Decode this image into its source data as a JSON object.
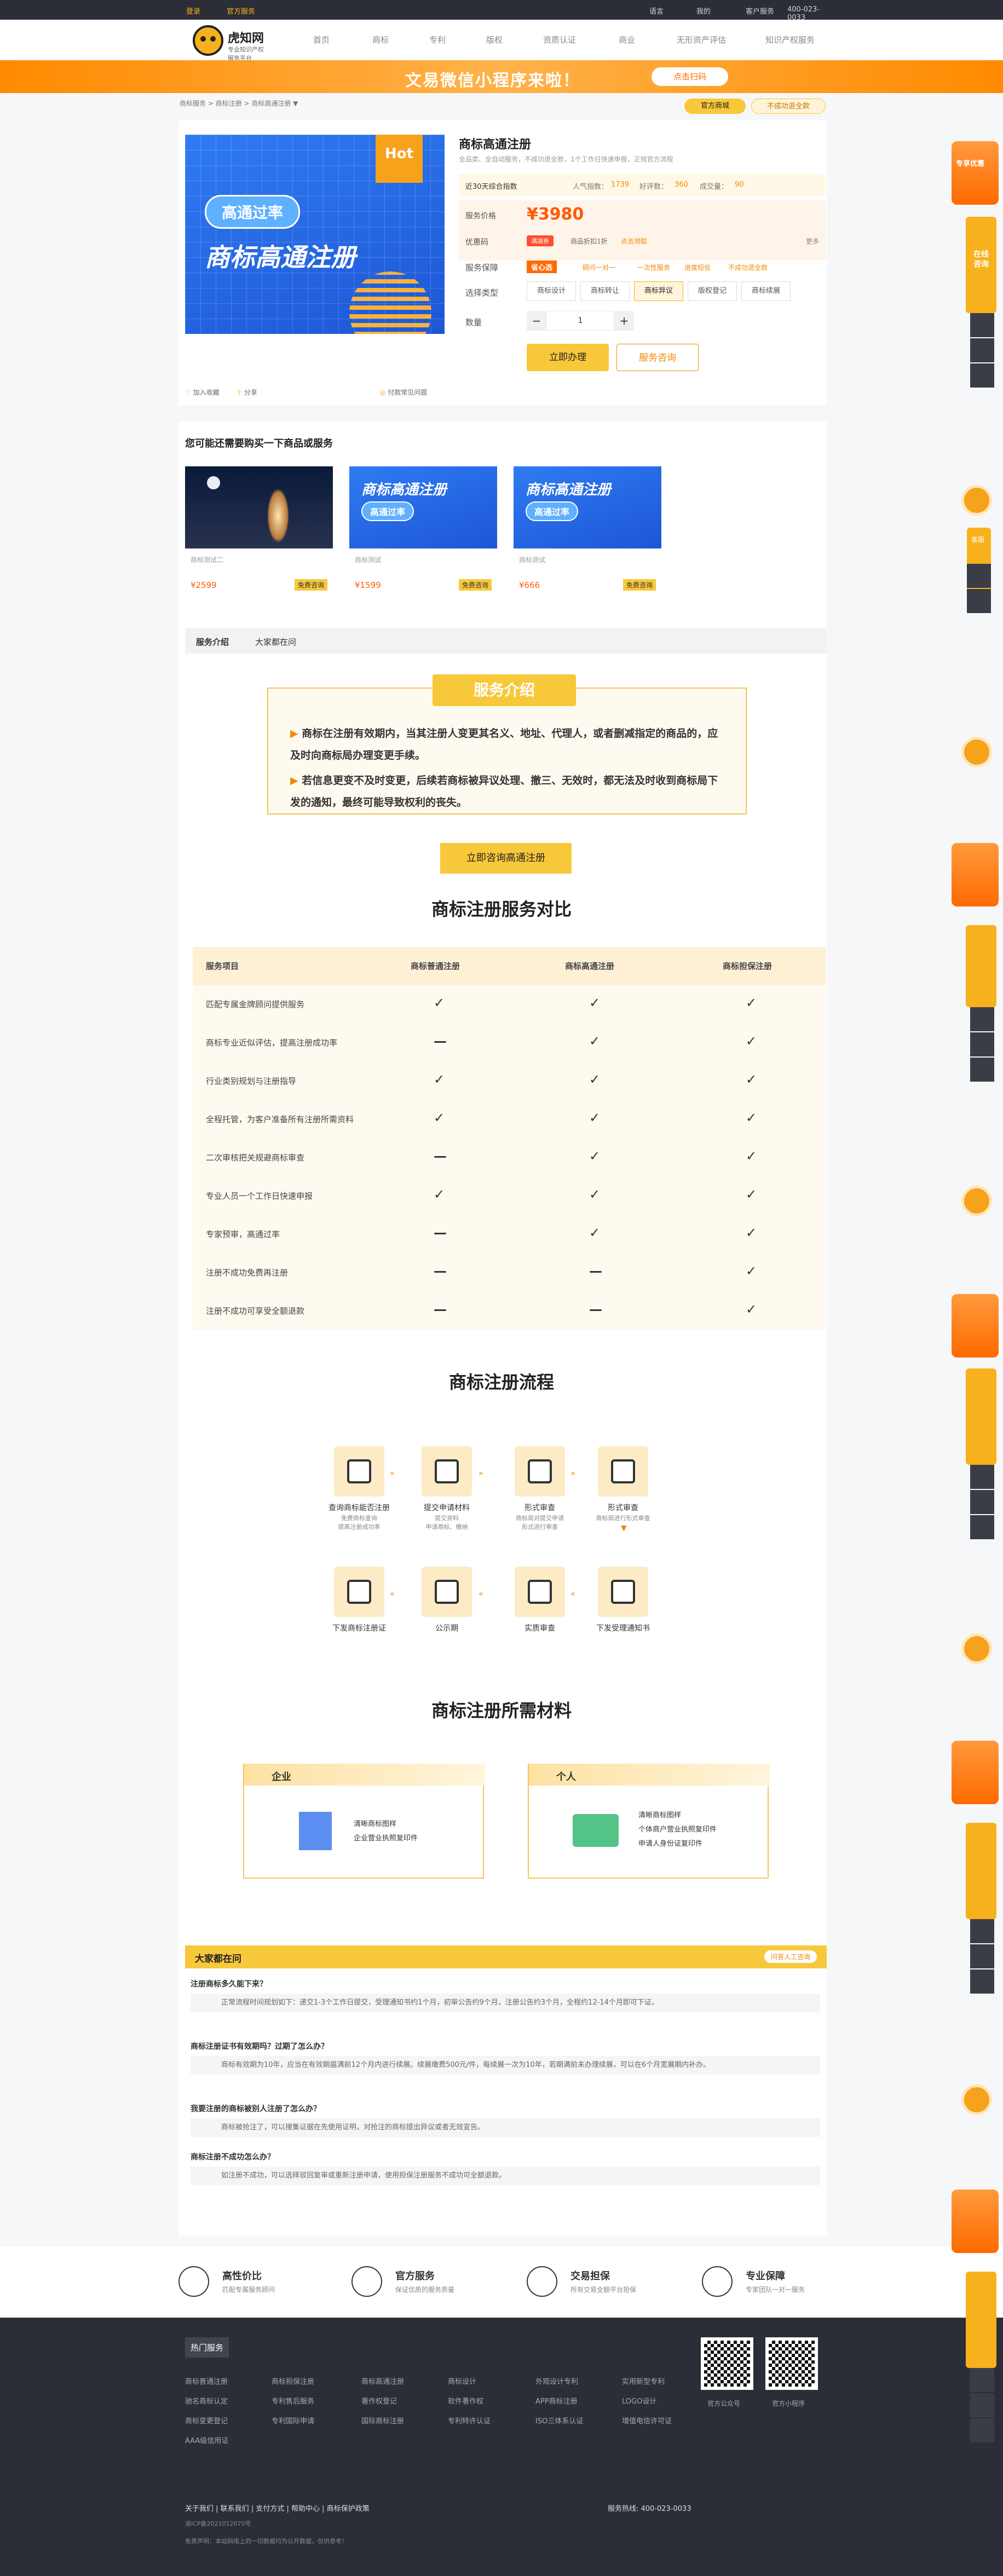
{
  "topbar": {
    "login": "登录",
    "site": "官方服务",
    "lang": "语言",
    "mine": "我的",
    "service": "客户服务",
    "phone": "400-023-0033"
  },
  "header": {
    "brand": "虎知网",
    "slogan": "专业知识产权服务平台",
    "nav": [
      "首页",
      "商标",
      "专利",
      "版权",
      "资质认证",
      "商业",
      "无形资产评估",
      "知识产权服务"
    ]
  },
  "banner": {
    "text": "文易微信小程序来啦！",
    "button": "点击扫码"
  },
  "breadcrumb": "商标服务 > 商标注册 > 商标高通注册 ▼",
  "pills": {
    "official": "官方商城",
    "secure": "不成功退全款"
  },
  "product": {
    "badge": "Hot",
    "tag": "高通过率",
    "image_title": "商标高通注册",
    "title": "商标高通注册",
    "subtitle": "全品类、全自动服务，不成功退全款，1个工作日快速申报，正规官方流程",
    "stats": {
      "rank": "近30天综合指数",
      "views_label": "人气指数：",
      "views": "1739",
      "reviews_label": "好评数：",
      "reviews": "360",
      "sales_label": "成交量：",
      "sales": "90"
    },
    "price_label": "服务价格",
    "price": "¥3980",
    "coupon_label": "优惠码",
    "coupon_tag": "满减券",
    "coupon_text": "商品折扣1折",
    "coupon_link": "点击领取",
    "more": "更多",
    "guarantee_label": "服务保障",
    "guarantee_badge": "省心选",
    "guarantees": [
      "顾问一对一",
      "一次性服务",
      "进度短信",
      "不成功退全款"
    ],
    "type_label": "选择类型",
    "types": [
      "商标设计",
      "商标转让",
      "商标异议",
      "版权登记",
      "商标续展"
    ],
    "type_selected": 2,
    "qty_label": "数量",
    "qty": "1",
    "buy": "立即办理",
    "consult": "服务咨询",
    "collect": "加入收藏",
    "share": "分享",
    "report": "付款常见问题"
  },
  "recommend": {
    "title": "您可能还需要购买一下商品或服务",
    "items": [
      {
        "name": "商标测试二",
        "price": "¥2599",
        "tag": "免费咨询"
      },
      {
        "name": "商标测试",
        "price": "¥1599",
        "tag": "免费咨询"
      },
      {
        "name": "商标测试",
        "price": "¥666",
        "tag": "免费咨询"
      }
    ],
    "banner_title": "商标高通注册",
    "banner_tag": "高通过率"
  },
  "tabs": [
    "服务介绍",
    "大家都在问"
  ],
  "intro": {
    "title": "服务介绍",
    "lines": [
      "商标在注册有效期内，当其注册人变更其名义、地址、代理人，或者删减指定的商品的，应及时向商标局办理变更手续。",
      "若信息更变不及时变更，后续若商标被异议处理、撤三、无效时，都无法及时收到商标局下发的通知，最终可能导致权利的丧失。"
    ],
    "button": "立即咨询高通注册"
  },
  "compare": {
    "title": "商标注册服务对比",
    "headers": [
      "服务项目",
      "商标普通注册",
      "商标高通注册",
      "商标担保注册"
    ],
    "rows": [
      {
        "item": "匹配专属金牌顾问提供服务",
        "c": [
          "✓",
          "✓",
          "✓"
        ]
      },
      {
        "item": "商标专业近似评估，提高注册成功率",
        "c": [
          "—",
          "✓",
          "✓"
        ]
      },
      {
        "item": "行业类别规划与注册指导",
        "c": [
          "✓",
          "✓",
          "✓"
        ]
      },
      {
        "item": "全程托管，为客户准备所有注册所需资料",
        "c": [
          "✓",
          "✓",
          "✓"
        ]
      },
      {
        "item": "二次审核把关规避商标审查",
        "c": [
          "—",
          "✓",
          "✓"
        ]
      },
      {
        "item": "专业人员一个工作日快速申报",
        "c": [
          "✓",
          "✓",
          "✓"
        ]
      },
      {
        "item": "专家预审，高通过率",
        "c": [
          "—",
          "✓",
          "✓"
        ]
      },
      {
        "item": "注册不成功免费再注册",
        "c": [
          "—",
          "—",
          "✓"
        ]
      },
      {
        "item": "注册不成功可享受全额退款",
        "c": [
          "—",
          "—",
          "✓"
        ]
      }
    ]
  },
  "flow": {
    "title": "商标注册流程",
    "steps": [
      {
        "label": "查询商标能否注册",
        "sub": "免费商标查询\n提高注册成功率"
      },
      {
        "label": "提交申请材料",
        "sub": "提交资料\n申请商标、缴纳"
      },
      {
        "label": "形式审查",
        "sub": "商标局对提交申请\n形式进行审查"
      },
      {
        "label": "形式审查",
        "sub": "商标局进行形式审查"
      },
      {
        "label": "下发受理通知书",
        "sub": ""
      },
      {
        "label": "实质审查",
        "sub": ""
      },
      {
        "label": "公示期",
        "sub": ""
      },
      {
        "label": "下发商标注册证",
        "sub": ""
      }
    ]
  },
  "materials": {
    "title": "商标注册所需材料",
    "enterprise": {
      "title": "企业",
      "items": [
        "清晰商标图样",
        "企业营业执照复印件"
      ]
    },
    "personal": {
      "title": "个人",
      "items": [
        "清晰商标图样",
        "个体商户营业执照复印件",
        "申请人身份证复印件"
      ]
    }
  },
  "faq": {
    "title": "大家都在问",
    "ask_btn": "问答人工咨询",
    "items": [
      {
        "q": "注册商标多久能下来？",
        "a": "正常流程时间规划如下：递交1-3个工作日提交，受理通知书约1个月，初审公告约9个月，注册公告约3个月，全程约12-14个月即可下证。"
      },
      {
        "q": "商标注册证书有效期吗？过期了怎么办？",
        "a": "商标有效期为10年，应当在有效期届满前12个月内进行续展。续展缴费500元/件，每续展一次为10年，若期满前未办理续展，可以在6个月宽展期内补办。"
      },
      {
        "q": "我要注册的商标被别人注册了怎么办？",
        "a": "商标被抢注了，可以搜集证据在先使用证明，对抢注的商标提出异议或者无效宣告。"
      },
      {
        "q": "商标注册不成功怎么办？",
        "a": "如注册不成功，可以选择驳回复审或重新注册申请，使用担保注册服务不成功可全额退款。"
      }
    ]
  },
  "features": [
    {
      "title": "高性价比",
      "sub": "匹配专属服务顾问"
    },
    {
      "title": "官方服务",
      "sub": "保证优质的服务质量"
    },
    {
      "title": "交易担保",
      "sub": "所有交易全额平台担保"
    },
    {
      "title": "专业保障",
      "sub": "专家团队一对一服务"
    }
  ],
  "footer": {
    "hot": "热门服务",
    "cols": [
      [
        "商标普通注册",
        "驰名商标认定",
        "商标变更登记",
        "AAA级信用证"
      ],
      [
        "商标担保注册",
        "专利售后服务",
        "专利国际申请"
      ],
      [
        "商标高通注册",
        "著作权登记",
        "国际商标注册"
      ],
      [
        "商标设计",
        "软件著作权",
        "专利特许认证"
      ],
      [
        "外观设计专利",
        "APP商标注册",
        "ISO三体系认证"
      ],
      [
        "实用新型专利",
        "LOGO设计",
        "增值电信许可证"
      ]
    ],
    "qr1": "官方公众号",
    "qr2": "官方小程序",
    "links": [
      "关于我们",
      "联系我们",
      "支付方式",
      "帮助中心",
      "商标保护政策"
    ],
    "hotline": "服务热线: 400-023-0033",
    "icp": "渝ICP备2021012070号",
    "copyright": "免责声明：本站网络上的一切数据均为公开数据，仅供参考！"
  },
  "side": {
    "label1": "专享优惠",
    "label2": "在线咨询",
    "label3": "客服"
  }
}
